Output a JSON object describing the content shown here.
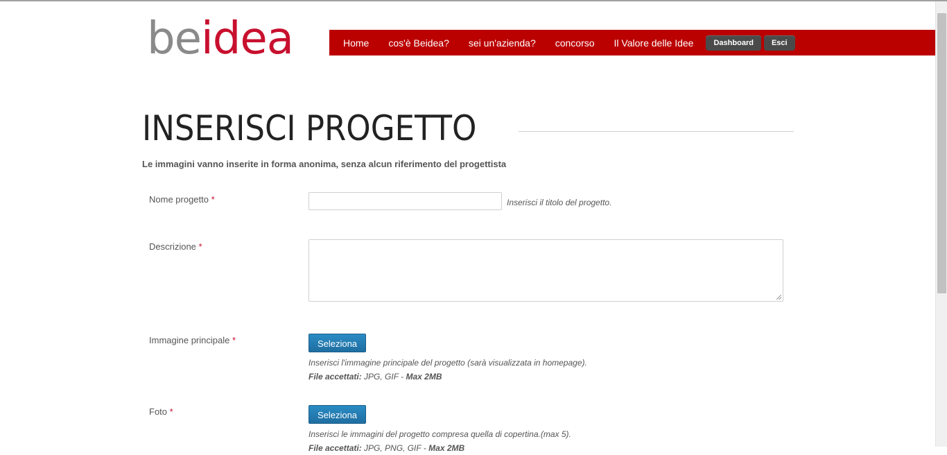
{
  "logo": {
    "part1": "be",
    "part2": "idea"
  },
  "nav": {
    "items": [
      "Home",
      "cos'è Beidea?",
      "sei un'azienda?",
      "concorso",
      "Il Valore delle Idee"
    ],
    "dashboard": "Dashboard",
    "exit": "Esci"
  },
  "page": {
    "title": "INSERISCI PROGETTO",
    "subtitle": "Le immagini vanno inserite in forma anonima, senza alcun riferimento del progettista"
  },
  "form": {
    "required_mark": "*",
    "name_label": "Nome progetto",
    "name_value": "",
    "name_hint": "Inserisci il titolo del progetto.",
    "description_label": "Descrizione",
    "description_value": "",
    "main_image_label": "Immagine principale",
    "select_label": "Seleziona",
    "main_image_help": "Inserisci l'immagine principale del progetto (sarà visualizzata in homepage).",
    "main_image_files_label": "File accettati:",
    "main_image_files_value": " JPG, GIF - ",
    "main_image_max": "Max 2MB",
    "photo_label": "Foto",
    "photo_help": "Inserisci le immagini del progetto compresa quella di copertina.(max 5).",
    "photo_files_label": "File accettati:",
    "photo_files_value": " JPG, PNG, GIF - ",
    "photo_max": "Max 2MB"
  },
  "colors": {
    "brand_red": "#bb0000",
    "logo_red": "#c8102e",
    "button_blue": "#2a8cc4"
  }
}
